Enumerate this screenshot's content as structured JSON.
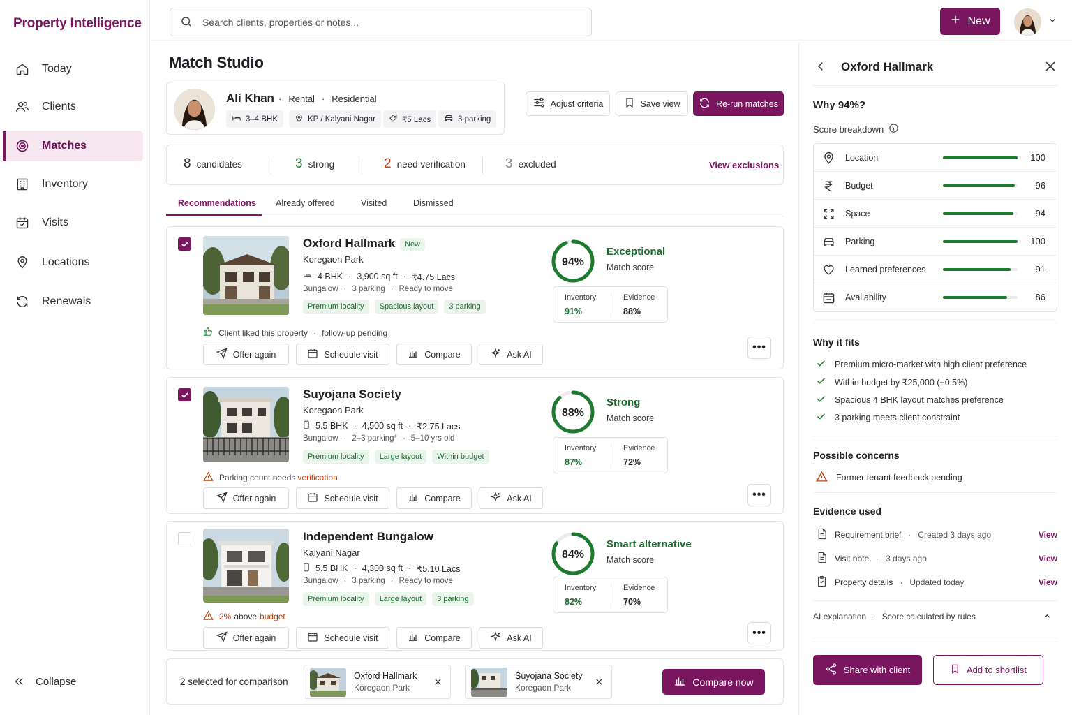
{
  "app": {
    "brand": "Property Intelligence"
  },
  "sidebar": {
    "items": [
      {
        "label": "Today",
        "icon": "home-icon"
      },
      {
        "label": "Clients",
        "icon": "users-icon"
      },
      {
        "label": "Matches",
        "icon": "target-icon",
        "active": true
      },
      {
        "label": "Inventory",
        "icon": "building-icon"
      },
      {
        "label": "Visits",
        "icon": "calendar-check-icon"
      },
      {
        "label": "Locations",
        "icon": "map-pin-icon"
      },
      {
        "label": "Renewals",
        "icon": "refresh-icon"
      }
    ],
    "collapse_label": "Collapse"
  },
  "topbar": {
    "search_placeholder": "Search clients, properties or notes...",
    "new_label": "New"
  },
  "page": {
    "title": "Match Studio"
  },
  "client": {
    "name": "Ali Khan",
    "type1": "Rental",
    "type2": "Residential",
    "chips": [
      "3–4 BHK",
      "KP / Kalyani Nagar",
      "₹5 Lacs",
      "3 parking"
    ]
  },
  "toolbar": {
    "adjust_label": "Adjust criteria",
    "save_view_label": "Save view",
    "rerun_label": "Re-run matches"
  },
  "stats": {
    "candidates_num": "8",
    "candidates_label": "candidates",
    "strong_num": "3",
    "strong_label": "strong",
    "verify_num": "2",
    "verify_label": "need verification",
    "excluded_num": "3",
    "excluded_label": "excluded",
    "view_exclusions": "View exclusions"
  },
  "tabs": [
    "Recommendations",
    "Already offered",
    "Visited",
    "Dismissed"
  ],
  "actions": {
    "offer": "Offer again",
    "schedule": "Schedule visit",
    "compare": "Compare",
    "ask": "Ask AI",
    "more": "•••"
  },
  "matches": [
    {
      "name": "Oxford Hallmark",
      "badge": "New",
      "location": "Koregaon Park",
      "bhk": "4 BHK",
      "area": "3,900 sq ft",
      "price": "₹4.75 Lacs",
      "kind": "Bungalow",
      "parking": "3 parking",
      "extra": "Ready to move",
      "tags": [
        "Premium locality",
        "Spacious layout",
        "3 parking"
      ],
      "note": "Client liked this property",
      "note2": "follow-up pending",
      "score": "94%",
      "score_value": 94,
      "label": "Exceptional",
      "sublabel": "Match score",
      "inventory_k": "Inventory",
      "inventory_v": "91%",
      "evidence_k": "Evidence",
      "evidence_v": "88%",
      "selected": true
    },
    {
      "name": "Suyojana Society",
      "badge": "",
      "location": "Koregaon Park",
      "bhk": "5.5 BHK",
      "area": "4,500 sq ft",
      "price": "₹2.75 Lacs",
      "kind": "Bungalow",
      "parking": "2–3 parking*",
      "extra": "5–10 yrs old",
      "tags": [
        "Premium locality",
        "Large layout",
        "Within budget"
      ],
      "note": "Parking count needs",
      "note_warn": "verification",
      "score": "88%",
      "score_value": 88,
      "label": "Strong",
      "sublabel": "Match score",
      "inventory_k": "Inventory",
      "inventory_v": "87%",
      "evidence_k": "Evidence",
      "evidence_v": "72%",
      "selected": true
    },
    {
      "name": "Independent Bungalow",
      "badge": "",
      "location": "Kalyani Nagar",
      "bhk": "5.5 BHK",
      "area": "4,300 sq ft",
      "price": "₹5.10 Lacs",
      "kind": "Bungalow",
      "parking": "3 parking",
      "extra": "Ready to move",
      "tags": [
        "Premium locality",
        "Large layout",
        "3 parking"
      ],
      "note_pct": "2%",
      "note": "above",
      "note_warn": "budget",
      "score": "84%",
      "score_value": 84,
      "label": "Smart alternative",
      "sublabel": "Match score",
      "inventory_k": "Inventory",
      "inventory_v": "82%",
      "evidence_k": "Evidence",
      "evidence_v": "70%",
      "selected": false
    }
  ],
  "compare": {
    "title": "2 selected for comparison",
    "items": [
      {
        "name": "Oxford Hallmark",
        "location": "Koregaon Park"
      },
      {
        "name": "Suyojana Society",
        "location": "Koregaon Park"
      }
    ],
    "button": "Compare now"
  },
  "panel": {
    "title": "Oxford Hallmark",
    "why": "Why 94%?",
    "breakdown": "Score breakdown",
    "scores": [
      {
        "label": "Location",
        "value": 100,
        "icon": "map-pin-icon"
      },
      {
        "label": "Budget",
        "value": 96,
        "icon": "rupee-icon"
      },
      {
        "label": "Space",
        "value": 94,
        "icon": "expand-icon"
      },
      {
        "label": "Parking",
        "value": 100,
        "icon": "car-icon"
      },
      {
        "label": "Learned preferences",
        "value": 91,
        "icon": "heart-icon"
      },
      {
        "label": "Availability",
        "value": 86,
        "icon": "calendar-icon"
      }
    ],
    "why_fits_title": "Why it fits",
    "why_fits": [
      "Premium micro-market with high client preference",
      "Within budget by ₹25,000 (−0.5%)",
      "Spacious 4 BHK layout matches preference",
      "3 parking meets client constraint"
    ],
    "concerns_title": "Possible concerns",
    "concerns": [
      "Former tenant feedback pending"
    ],
    "evidence_title": "Evidence used",
    "evidence": [
      {
        "name": "Requirement brief",
        "meta": "Created 3 days ago",
        "action": "View"
      },
      {
        "name": "Visit note",
        "meta": "3 days ago",
        "action": "View"
      },
      {
        "name": "Property details",
        "meta": "Updated today",
        "action": "View"
      }
    ],
    "ai_label": "AI explanation",
    "ai_meta": "Score calculated by rules",
    "share": "Share with client",
    "shortlist": "Add to shortlist"
  },
  "colors": {
    "brand": "#7a1560",
    "good": "#1d7a2f",
    "warn": "#c0400e"
  }
}
